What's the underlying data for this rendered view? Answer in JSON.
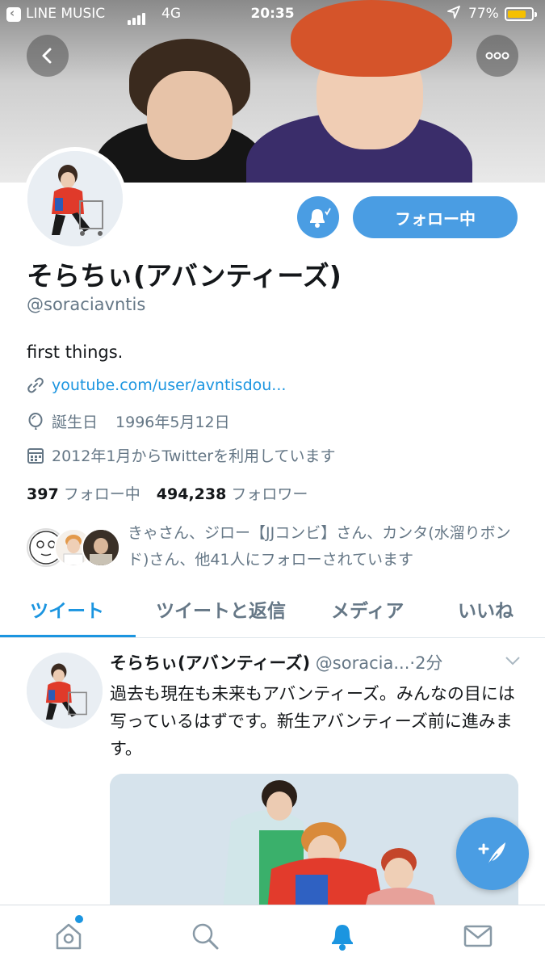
{
  "status_bar": {
    "app": "LINE MUSIC",
    "network": "4G",
    "time": "20:35",
    "battery": "77%",
    "battery_level": 0.77
  },
  "profile": {
    "display_name": "そらちぃ(アバンティーズ)",
    "handle": "@soraciavntis",
    "bio": "first things.",
    "link": "youtube.com/user/avntisdou...",
    "birthday_label": "誕生日",
    "birthday": "1996年5月12日",
    "joined": "2012年1月からTwitterを利用しています",
    "following_count": "397",
    "following_label": "フォロー中",
    "followers_count": "494,238",
    "followers_label": "フォロワー",
    "followed_by": "きゃさん、ジロー【JJコンビ】さん、カンタ(水溜りボンド)さん、他41人にフォローされています"
  },
  "actions": {
    "follow_label": "フォロー中"
  },
  "tabs": [
    {
      "label": "ツイート"
    },
    {
      "label": "ツイートと返信"
    },
    {
      "label": "メディア"
    },
    {
      "label": "いいね"
    }
  ],
  "tweet": {
    "name": "そらちぃ(アバンティーズ)",
    "handle": "@soracia...",
    "time": "2分",
    "text": "過去も現在も未来もアバンティーズ。みんなの目には写っているはずです。新生アバンティーズ前に進みます。"
  },
  "colors": {
    "accent": "#1b95e0",
    "button": "#4a9de3",
    "muted": "#657786"
  },
  "icons": [
    "back-icon",
    "more-icon",
    "bell-icon",
    "link-icon",
    "balloon-icon",
    "calendar-icon",
    "chevron-down-icon",
    "compose-icon",
    "home-icon",
    "search-icon",
    "notification-icon",
    "mail-icon"
  ]
}
